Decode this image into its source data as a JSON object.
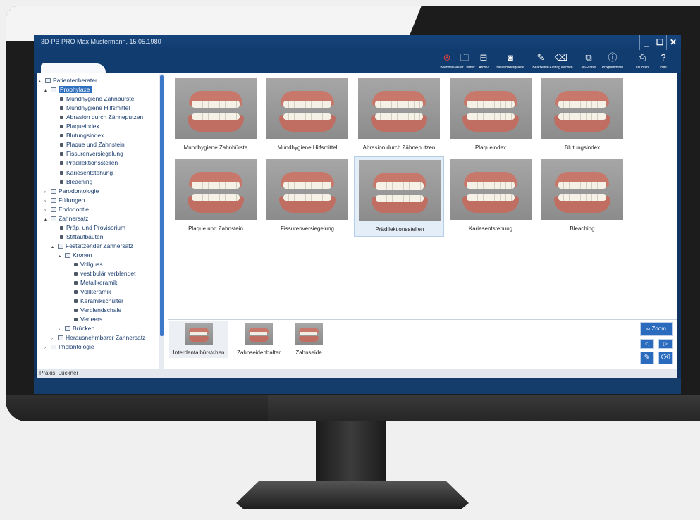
{
  "app": {
    "title": "3D-PB PRO Max Mustermann, 15.05.1980",
    "window_buttons": [
      "_",
      "☐",
      "✕"
    ]
  },
  "toolbar": [
    {
      "label": "Beenden",
      "icon": "close-circle-icon",
      "glyph": "⊗",
      "color": "#e0403a"
    },
    {
      "label": "Neuer Ordner",
      "icon": "new-folder-icon",
      "glyph": "🗀",
      "color": "#ffffff"
    },
    {
      "label": "Archiv",
      "icon": "archive-icon",
      "glyph": "⊟",
      "color": "#ffffff"
    },
    {
      "label": "Neue Bildergalerie",
      "icon": "camera-icon",
      "glyph": "◙",
      "color": "#ffffff"
    },
    {
      "label": "Bearbeiten",
      "icon": "pencil-icon",
      "glyph": "✎",
      "color": "#ffffff"
    },
    {
      "label": "Eintrag löschen",
      "icon": "trash-icon",
      "glyph": "⌫",
      "color": "#ffffff"
    },
    {
      "label": "3D-Planer",
      "icon": "planner-icon",
      "glyph": "⧉",
      "color": "#ffffff"
    },
    {
      "label": "Programminfo",
      "icon": "info-icon",
      "glyph": "ⓘ",
      "color": "#ffffff"
    },
    {
      "label": "Drucken",
      "icon": "printer-icon",
      "glyph": "⎙",
      "color": "#ffffff"
    },
    {
      "label": "Hilfe",
      "icon": "help-icon",
      "glyph": "?",
      "color": "#ffffff"
    }
  ],
  "tree": [
    {
      "label": "Patientenberater",
      "type": "folder",
      "level": 0,
      "arrow": "▴"
    },
    {
      "label": "Prophylaxe",
      "type": "folder",
      "level": 1,
      "arrow": "▴",
      "selected": true
    },
    {
      "label": "Mundhygiene Zahnbürste",
      "type": "leaf",
      "level": 2
    },
    {
      "label": "Mundhygiene Hilfsmittel",
      "type": "leaf",
      "level": 2
    },
    {
      "label": "Abrasion durch Zähneputzen",
      "type": "leaf",
      "level": 2
    },
    {
      "label": "Plaqueindex",
      "type": "leaf",
      "level": 2
    },
    {
      "label": "Blutungsindex",
      "type": "leaf",
      "level": 2
    },
    {
      "label": "Plaque und Zahnstein",
      "type": "leaf",
      "level": 2
    },
    {
      "label": "Fissurenversiegelung",
      "type": "leaf",
      "level": 2
    },
    {
      "label": "Prädilektionsstellen",
      "type": "leaf",
      "level": 2
    },
    {
      "label": "Kariesentstehung",
      "type": "leaf",
      "level": 2
    },
    {
      "label": "Bleaching",
      "type": "leaf",
      "level": 2
    },
    {
      "label": "Parodontologie",
      "type": "folder",
      "level": 1,
      "arrow": "›"
    },
    {
      "label": "Füllungen",
      "type": "folder",
      "level": 1,
      "arrow": "›"
    },
    {
      "label": "Endodontie",
      "type": "folder",
      "level": 1,
      "arrow": "›"
    },
    {
      "label": "Zahnersatz",
      "type": "folder",
      "level": 1,
      "arrow": "▴"
    },
    {
      "label": "Präp. und Provisorium",
      "type": "leaf",
      "level": 2
    },
    {
      "label": "Stiftaufbauten",
      "type": "leaf",
      "level": 2
    },
    {
      "label": "Festsitzender Zahnersatz",
      "type": "folder",
      "level": 2,
      "arrow": "▴"
    },
    {
      "label": "Kronen",
      "type": "folder",
      "level": 3,
      "arrow": "▴"
    },
    {
      "label": "Vollguss",
      "type": "leaf",
      "level": 4
    },
    {
      "label": "vestibulär verblendet",
      "type": "leaf",
      "level": 4
    },
    {
      "label": "Metallkeramik",
      "type": "leaf",
      "level": 4
    },
    {
      "label": "Vollkeramik",
      "type": "leaf",
      "level": 4
    },
    {
      "label": "Keramikschulter",
      "type": "leaf",
      "level": 4
    },
    {
      "label": "Verblendschale",
      "type": "leaf",
      "level": 4
    },
    {
      "label": "Veneers",
      "type": "leaf",
      "level": 4
    },
    {
      "label": "Brücken",
      "type": "folder",
      "level": 3,
      "arrow": "›"
    },
    {
      "label": "Herausnehmbarer Zahnersatz",
      "type": "folder",
      "level": 2,
      "arrow": "›"
    },
    {
      "label": "Implantologie",
      "type": "folder",
      "level": 1,
      "arrow": "›"
    }
  ],
  "gallery": [
    {
      "caption": "Mundhygiene Zahnbürste"
    },
    {
      "caption": "Mundhygiene Hilfsmittel"
    },
    {
      "caption": "Abrasion durch Zähneputzen"
    },
    {
      "caption": "Plaqueindex"
    },
    {
      "caption": "Blutungsindex"
    },
    {
      "caption": "Plaque und Zahnstein"
    },
    {
      "caption": "Fissurenversiegelung"
    },
    {
      "caption": "Prädilektionsstellen",
      "selected": true
    },
    {
      "caption": "Kariesentstehung"
    },
    {
      "caption": "Bleaching"
    }
  ],
  "strip": [
    {
      "caption": "Interdentalbürstchen",
      "active": true
    },
    {
      "caption": "Zahnseidenhalter"
    },
    {
      "caption": "Zahnseide"
    }
  ],
  "side_buttons": {
    "zoom_label": "Zoom",
    "prev_glyph": "◁",
    "next_glyph": "▷",
    "edit_glyph": "✎",
    "delete_glyph": "⌫"
  },
  "status": {
    "text": "Praxis: Luckner"
  },
  "colors": {
    "accent": "#2f6fbf",
    "titlebar": "#113c70",
    "close": "#e0403a"
  }
}
